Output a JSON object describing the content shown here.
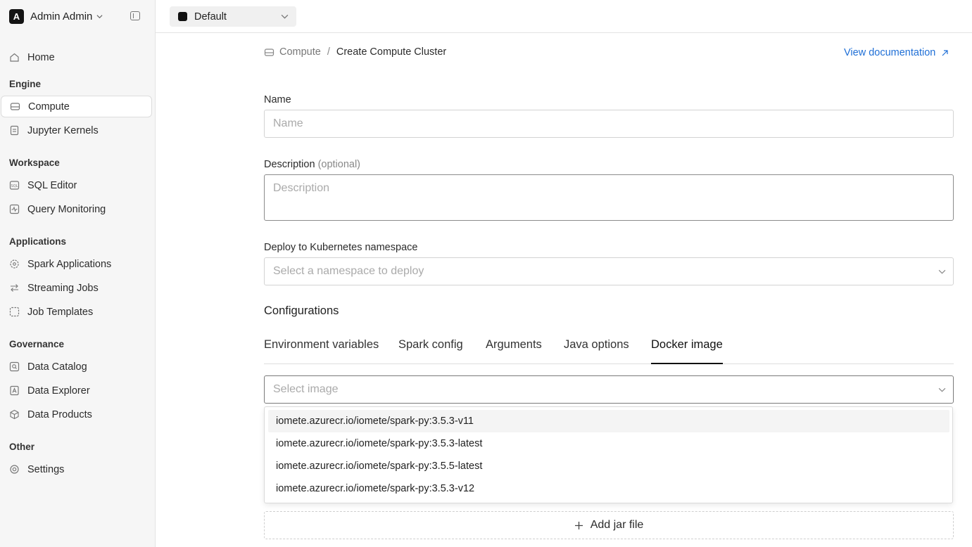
{
  "app": {
    "user_initial": "A",
    "user_name": "Admin Admin",
    "workspace": "Default"
  },
  "sidebar": {
    "home": "Home",
    "sections": {
      "engine": "Engine",
      "workspace": "Workspace",
      "applications": "Applications",
      "governance": "Governance",
      "other": "Other"
    },
    "items": {
      "compute": "Compute",
      "jupyter_kernels": "Jupyter Kernels",
      "sql_editor": "SQL Editor",
      "query_monitoring": "Query Monitoring",
      "spark_applications": "Spark Applications",
      "streaming_jobs": "Streaming Jobs",
      "job_templates": "Job Templates",
      "data_catalog": "Data Catalog",
      "data_explorer": "Data Explorer",
      "data_products": "Data Products",
      "settings": "Settings"
    },
    "active_item": "Compute"
  },
  "breadcrumb": {
    "parent": "Compute",
    "separator": "/",
    "current": "Create Compute Cluster"
  },
  "header": {
    "doc_link": "View documentation"
  },
  "form": {
    "name_label": "Name",
    "name_placeholder": "Name",
    "description_label": "Description",
    "description_optional": "(optional)",
    "description_placeholder": "Description",
    "namespace_label": "Deploy to Kubernetes namespace",
    "namespace_placeholder": "Select a namespace to deploy",
    "configurations_title": "Configurations"
  },
  "tabs": [
    {
      "label": "Environment variables",
      "active": false
    },
    {
      "label": "Spark config",
      "active": false
    },
    {
      "label": "Arguments",
      "active": false
    },
    {
      "label": "Java options",
      "active": false
    },
    {
      "label": "Docker image",
      "active": true
    }
  ],
  "docker_image": {
    "select_placeholder": "Select image",
    "options": [
      "iomete.azurecr.io/iomete/spark-py:3.5.3-v11",
      "iomete.azurecr.io/iomete/spark-py:3.5.3-latest",
      "iomete.azurecr.io/iomete/spark-py:3.5.5-latest",
      "iomete.azurecr.io/iomete/spark-py:3.5.3-v12"
    ],
    "highlighted_index": 0
  },
  "add_jar_label": "Add jar file",
  "colors": {
    "link": "#1f6fd6",
    "sidebar_bg": "#f6f6f6",
    "text": "#1f1f1f"
  }
}
